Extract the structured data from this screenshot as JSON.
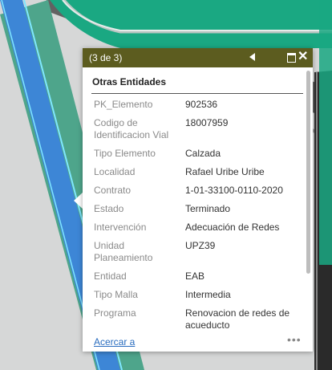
{
  "popup": {
    "pager": "(3 de 3)",
    "header_title": "Otras Entidades",
    "attributes": [
      {
        "label": "PK_Elemento",
        "value": "902536"
      },
      {
        "label": "Codigo de Identificacion Vial",
        "value": "18007959"
      },
      {
        "label": "Tipo Elemento",
        "value": "Calzada"
      },
      {
        "label": "Localidad",
        "value": "Rafael Uribe Uribe"
      },
      {
        "label": "Contrato",
        "value": "1-01-33100-0110-2020"
      },
      {
        "label": "Estado",
        "value": "Terminado"
      },
      {
        "label": "Intervención",
        "value": "Adecuación de Redes"
      },
      {
        "label": "Unidad Planeamiento",
        "value": "UPZ39"
      },
      {
        "label": "Entidad",
        "value": "EAB"
      },
      {
        "label": "Tipo Malla",
        "value": "Intermedia"
      },
      {
        "label": "Programa",
        "value": "Renovacion de redes de acueducto"
      }
    ],
    "footer": {
      "zoom_link": "Acercar a",
      "more_menu": "•••"
    },
    "icons": {
      "previous": "triangle-left-icon",
      "maximize": "maximize-icon",
      "close": "close-icon"
    },
    "close_glyph": "✕"
  },
  "colors": {
    "titlebar": "#5c5c1f",
    "map_background": "#d7d8d8",
    "road_teal": "#1aa882",
    "road_blue": "#3d86d6",
    "link": "#2a6dbf"
  }
}
